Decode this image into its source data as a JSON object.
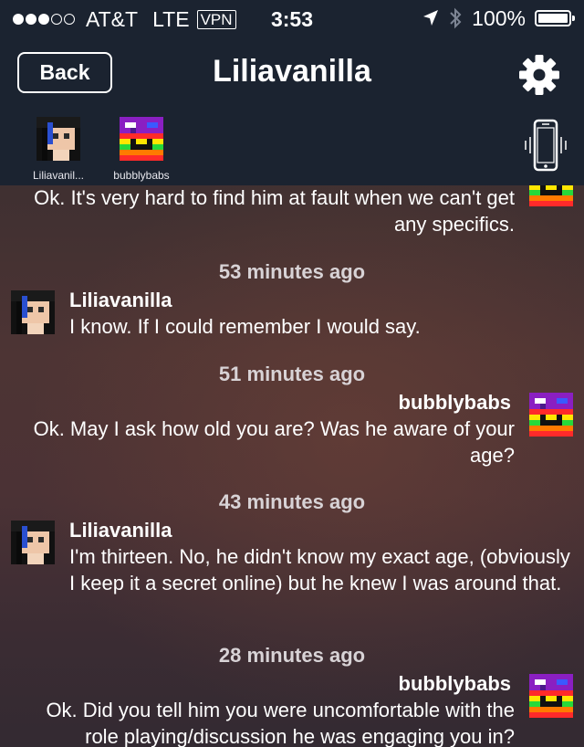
{
  "status_bar": {
    "carrier": "AT&T",
    "network": "LTE",
    "vpn": "VPN",
    "time": "3:53",
    "battery": "100%",
    "signal_bars_filled": 3,
    "signal_bars_total": 5,
    "icons": [
      "location-arrow-icon",
      "bluetooth-icon",
      "battery-icon"
    ]
  },
  "nav": {
    "back_label": "Back",
    "title": "Liliavanilla",
    "settings_icon": "gear-icon"
  },
  "participants": [
    {
      "name": "Liliavanilla",
      "display": "Liliavanil..."
    },
    {
      "name": "bubblybabs",
      "display": "bubblybabs"
    }
  ],
  "vibrate_icon": "phone-vibrate-icon",
  "messages": [
    {
      "sender": "bubblybabs",
      "side": "right",
      "text": "Ok.  It's very hard to find him at fault when we can't get any specifics."
    },
    {
      "timestamp": "53 minutes ago",
      "sender": "Liliavanilla",
      "side": "left",
      "text": "I know. If I could remember I would say."
    },
    {
      "timestamp": "51 minutes ago",
      "sender": "bubblybabs",
      "side": "right",
      "text": "Ok.  May I ask how old you are?  Was he aware of your age?"
    },
    {
      "timestamp": "43 minutes ago",
      "sender": "Liliavanilla",
      "side": "left",
      "text": "I'm thirteen. No, he didn't know my exact age, (obviously I keep it a secret online) but he knew I was around that."
    },
    {
      "timestamp": "28 minutes ago",
      "sender": "bubblybabs",
      "side": "right",
      "text": "Ok.  Did you tell him you were uncomfortable with the role playing/discussion he was engaging you in?"
    }
  ],
  "colors": {
    "chrome_bg": "#1b2330",
    "chat_bg": "#4b3235",
    "text": "#ffffff",
    "timestamp": "#d8d3d6"
  }
}
